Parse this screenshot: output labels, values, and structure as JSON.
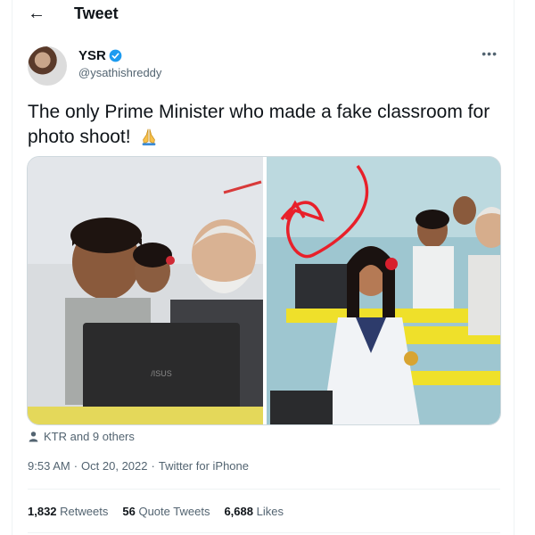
{
  "header": {
    "title": "Tweet",
    "back_icon": "back-arrow-icon"
  },
  "author": {
    "name": "YSR",
    "handle": "@ysathishreddy",
    "verified": true
  },
  "more_label": "•••",
  "tweet": {
    "text": "The only Prime Minister who made a fake classroom for photo shoot!"
  },
  "media": {
    "laptop_brand": "/ISUS"
  },
  "likers": "KTR and 9 others",
  "meta": {
    "time": "9:53 AM",
    "dot": "·",
    "date": "Oct 20, 2022",
    "dot2": "·",
    "source": "Twitter for iPhone"
  },
  "stats": {
    "retweets_count": "1,832",
    "retweets_label": "Retweets",
    "quotes_count": "56",
    "quotes_label": "Quote Tweets",
    "likes_count": "6,688",
    "likes_label": "Likes"
  },
  "colors": {
    "verified": "#1d9bf0",
    "muted": "#536471"
  }
}
